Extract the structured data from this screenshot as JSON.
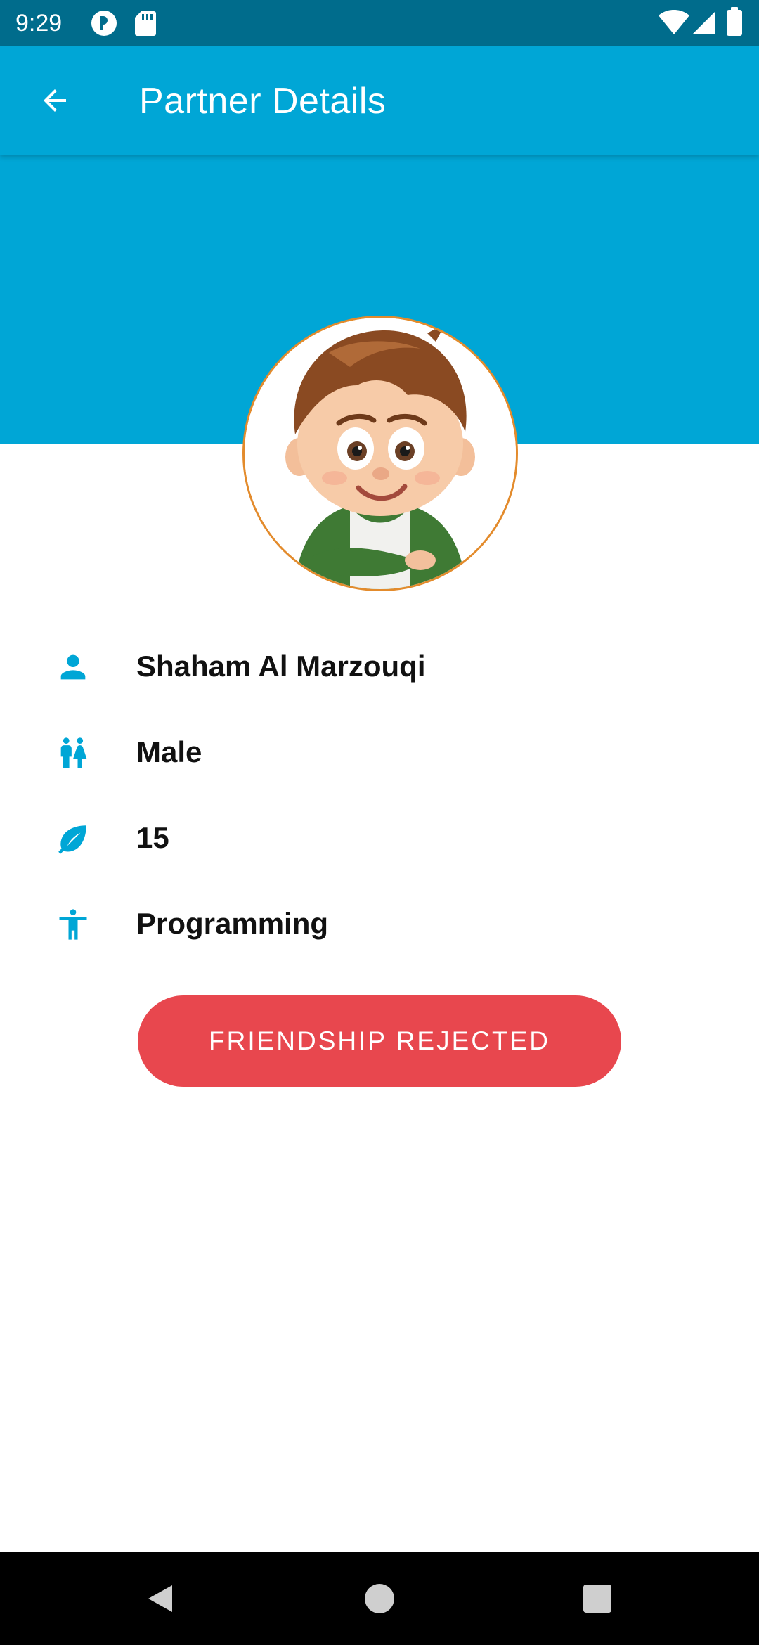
{
  "status_bar": {
    "time": "9:29",
    "icons": [
      "app-indicator-icon",
      "sd-card-icon",
      "wifi-icon",
      "signal-icon",
      "battery-icon"
    ]
  },
  "app_bar": {
    "back_icon": "arrow-back-icon",
    "title": "Partner Details"
  },
  "colors": {
    "primary": "#00a6d6",
    "status_bar": "#006c8c",
    "avatar_border": "#e38b2c",
    "reject_button": "#e8474e",
    "text": "#111111"
  },
  "partner": {
    "avatar_icon": "cartoon-boy-avatar",
    "details": [
      {
        "icon": "person-icon",
        "value": "Shaham Al Marzouqi"
      },
      {
        "icon": "gender-icon",
        "value": "Male"
      },
      {
        "icon": "leaf-icon",
        "value": "15"
      },
      {
        "icon": "accessibility-icon",
        "value": "Programming"
      }
    ]
  },
  "action": {
    "label": "FRIENDSHIP REJECTED"
  },
  "nav": {
    "items": [
      "back-triangle-icon",
      "home-circle-icon",
      "recents-square-icon"
    ]
  }
}
